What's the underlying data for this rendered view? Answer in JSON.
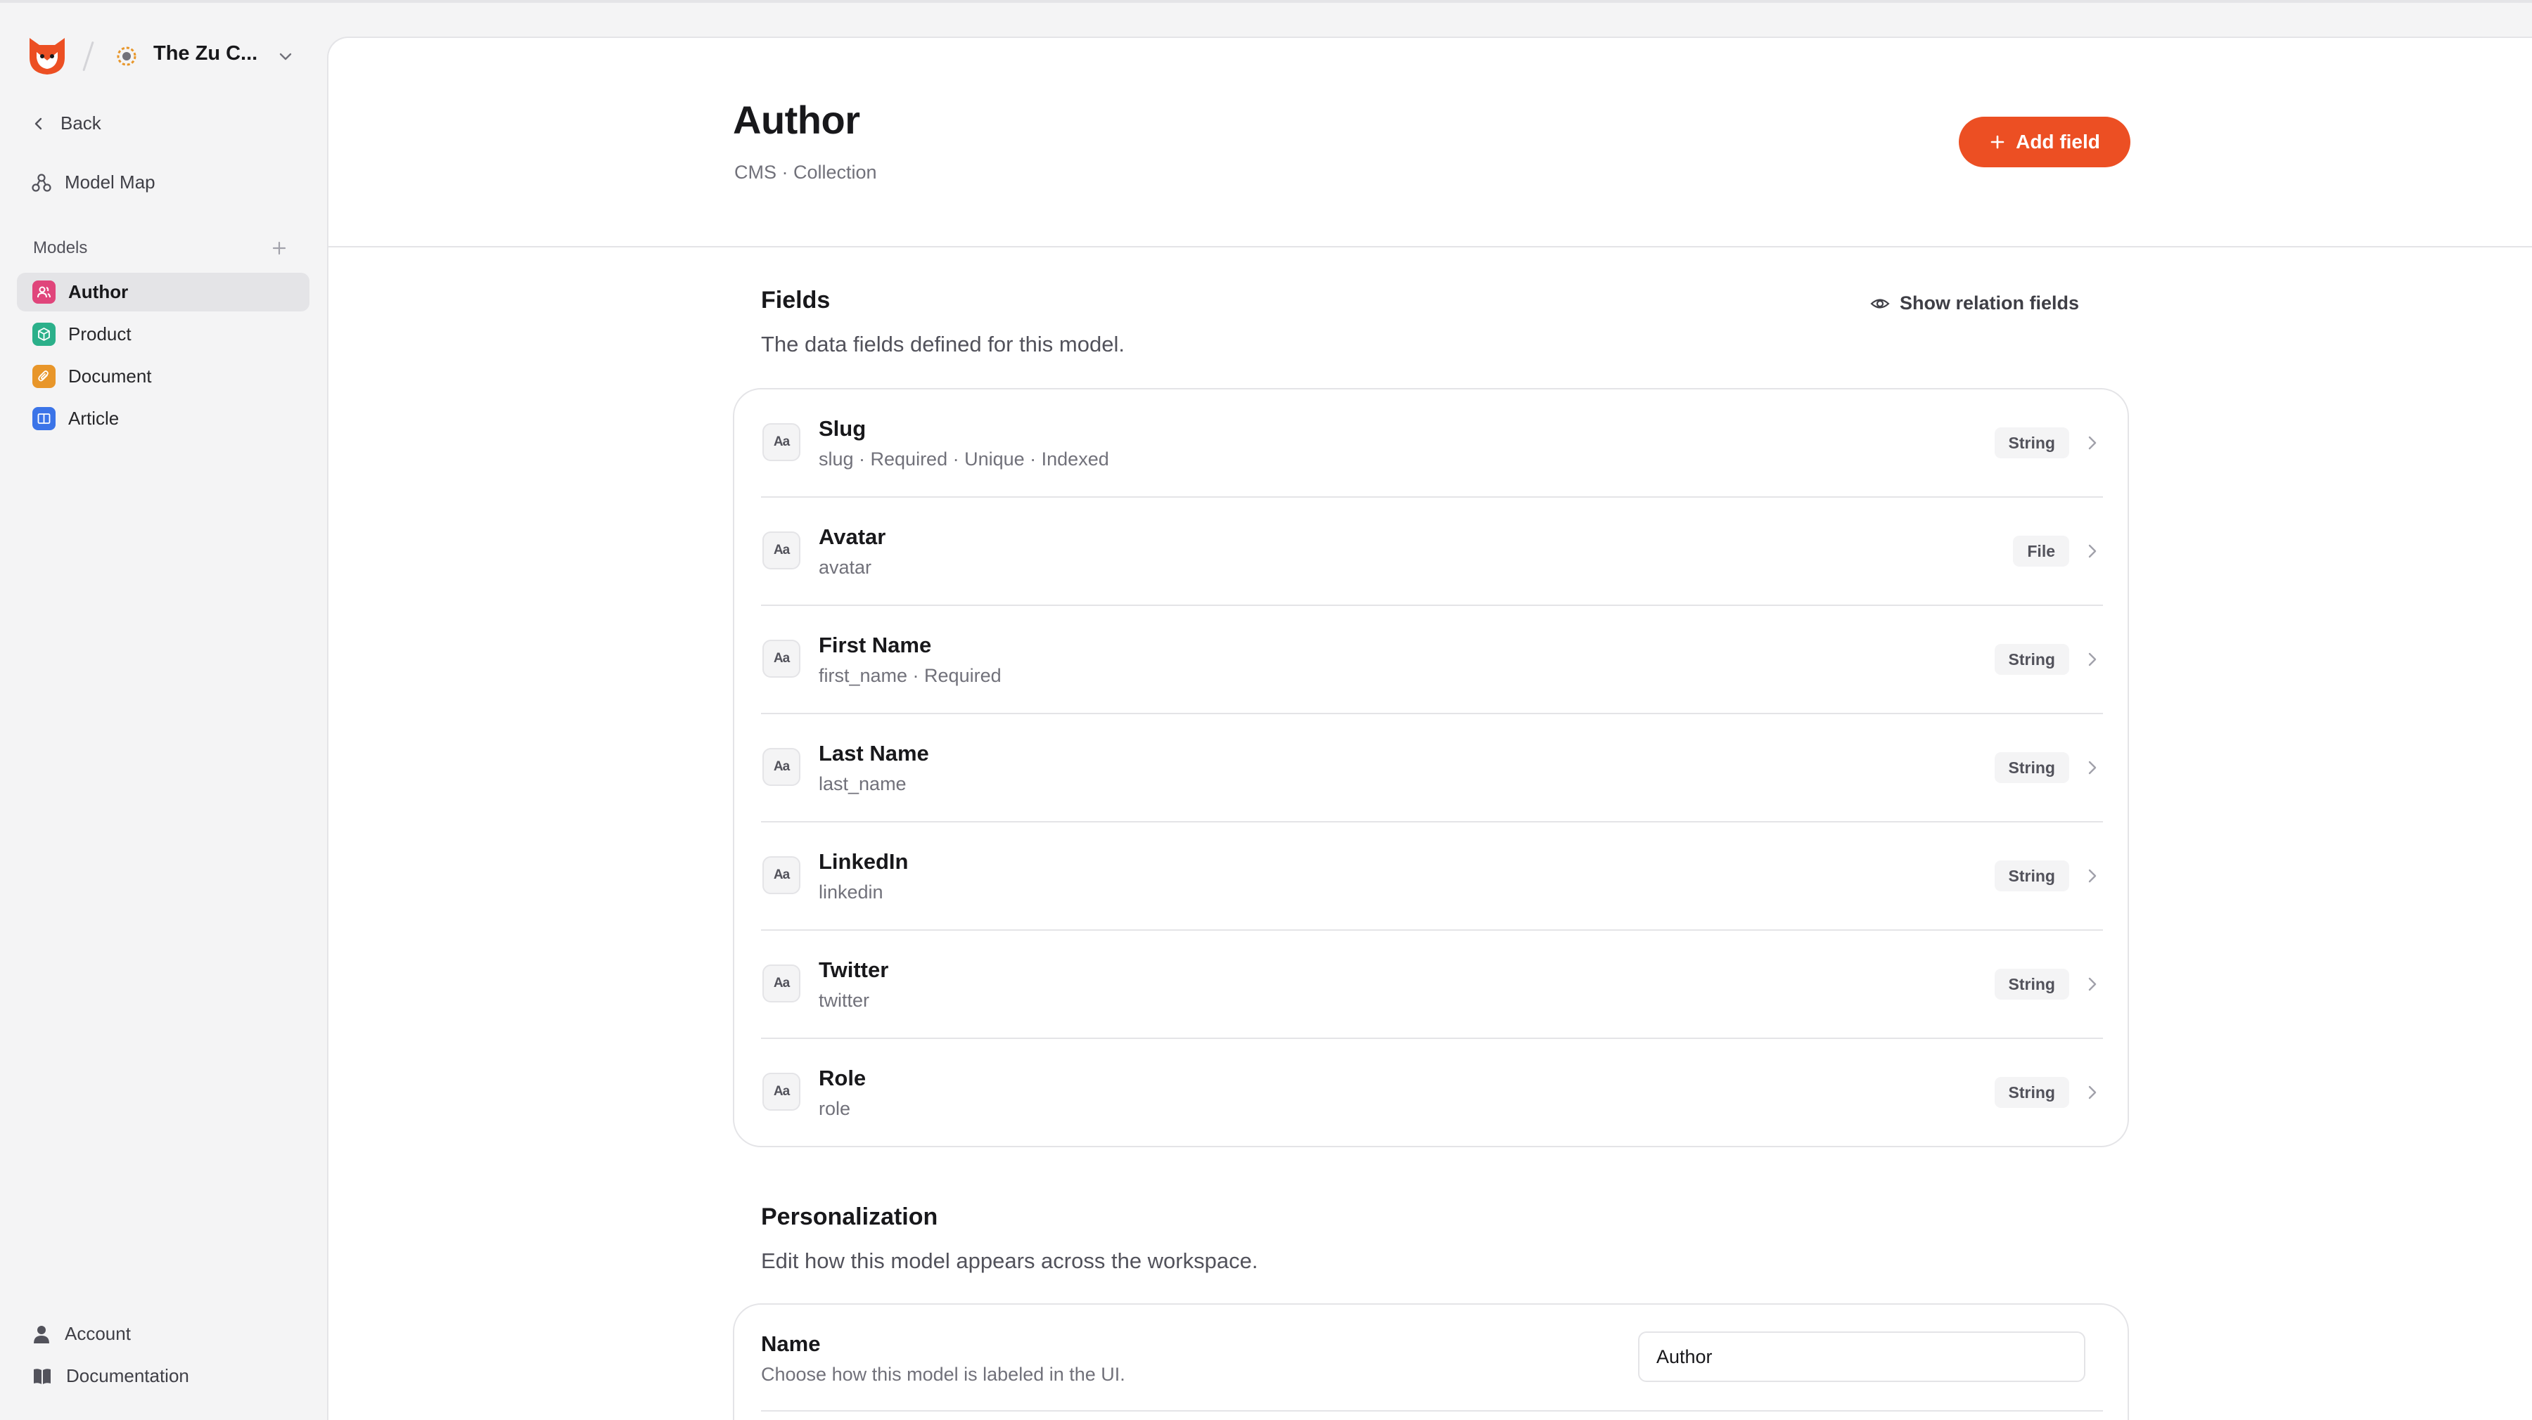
{
  "workspace": {
    "name": "The Zu C..."
  },
  "nav": {
    "back": "Back",
    "model_map": "Model Map"
  },
  "models": {
    "header": "Models",
    "items": [
      {
        "label": "Author",
        "color": "#e0457b",
        "active": true
      },
      {
        "label": "Product",
        "color": "#2bb08a",
        "active": false
      },
      {
        "label": "Document",
        "color": "#e8962a",
        "active": false
      },
      {
        "label": "Article",
        "color": "#3b74e8",
        "active": false
      }
    ]
  },
  "footer": {
    "account": "Account",
    "documentation": "Documentation"
  },
  "page": {
    "title": "Author",
    "subtitle": "CMS · Collection",
    "add_field": "Add field"
  },
  "fields_section": {
    "title": "Fields",
    "description": "The data fields defined for this model.",
    "show_relations": "Show relation fields",
    "icon_text": "Aa",
    "rows": [
      {
        "name": "Slug",
        "meta": "slug · Required · Unique · Indexed",
        "type": "String"
      },
      {
        "name": "Avatar",
        "meta": "avatar",
        "type": "File"
      },
      {
        "name": "First Name",
        "meta": "first_name · Required",
        "type": "String"
      },
      {
        "name": "Last Name",
        "meta": "last_name",
        "type": "String"
      },
      {
        "name": "LinkedIn",
        "meta": "linkedin",
        "type": "String"
      },
      {
        "name": "Twitter",
        "meta": "twitter",
        "type": "String"
      },
      {
        "name": "Role",
        "meta": "role",
        "type": "String"
      }
    ]
  },
  "personalization": {
    "title": "Personalization",
    "description": "Edit how this model appears across the workspace.",
    "name_label": "Name",
    "name_desc": "Choose how this model is labeled in the UI.",
    "name_value": "Author"
  },
  "colors": {
    "accent": "#ec4f23"
  }
}
